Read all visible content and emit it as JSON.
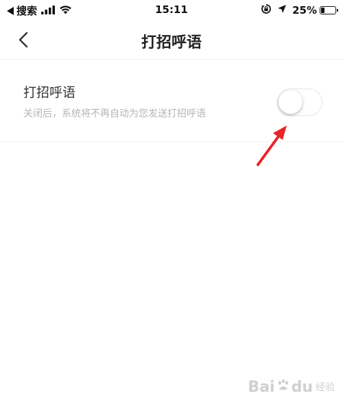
{
  "status_bar": {
    "carrier": "搜索",
    "time": "15:11",
    "battery_percent": "25%",
    "battery_level": 0.25
  },
  "nav": {
    "title": "打招呼语"
  },
  "setting": {
    "title": "打招呼语",
    "description": "关闭后，系统将不再自动为您发送打招呼语",
    "enabled": false
  },
  "watermark": {
    "brand": "Bai",
    "brand_tail": "du",
    "sub": "经验"
  },
  "colors": {
    "annotation_arrow": "#e8262a",
    "toggle_border": "#e6e6e6",
    "description_text": "#b5b5b5"
  }
}
